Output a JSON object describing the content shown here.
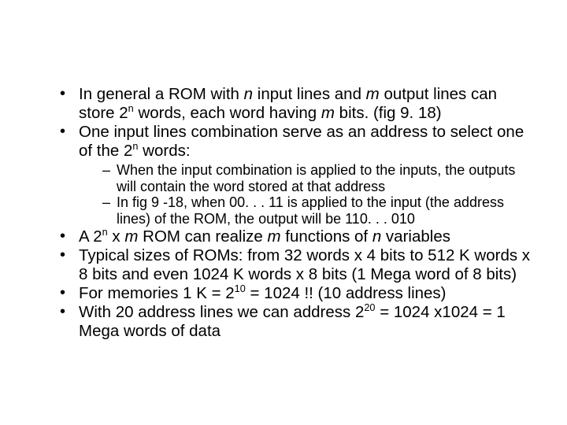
{
  "bullets": {
    "b1_a": "In general a ROM with ",
    "b1_n": "n",
    "b1_b": " input lines and ",
    "b1_m": "m",
    "b1_c": " output lines can store 2",
    "b1_exp": "n",
    "b1_d": " words, each word having ",
    "b1_m2": "m",
    "b1_e": " bits. (fig 9. 18)",
    "b2_a": "One input lines combination serve as an address to select one of the 2",
    "b2_exp": "n",
    "b2_b": " words:",
    "s1": "When the input combination is applied to the inputs, the outputs will contain the word stored at that address",
    "s2": "In fig 9 -18, when 00. . . 11 is applied to the input (the address lines) of the ROM, the output will be 110. . . 010",
    "b3_a": "A  2",
    "b3_exp": "n",
    "b3_b": " x ",
    "b3_m": "m",
    "b3_c": " ROM can realize ",
    "b3_m2": "m",
    "b3_d": " functions of ",
    "b3_n": "n",
    "b3_e": " variables",
    "b4": "Typical sizes of ROMs: from 32 words x 4 bits to 512 K words x 8 bits and even 1024 K words x 8 bits (1 Mega word of 8 bits)",
    "b5_a": "For memories 1 K = 2",
    "b5_exp": "10",
    "b5_b": " = 1024 !! (10 address lines)",
    "b6_a": "With 20 address lines we can address 2",
    "b6_exp": "20",
    "b6_b": " = 1024 x1024 = 1 Mega words of data"
  }
}
